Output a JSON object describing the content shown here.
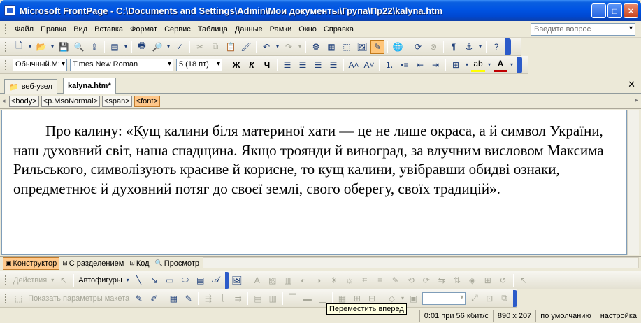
{
  "window": {
    "title": "Microsoft FrontPage - C:\\Documents and Settings\\Admin\\Мои документы\\Група\\Пр22\\kalyna.htm"
  },
  "menu": {
    "items": [
      "Файл",
      "Правка",
      "Вид",
      "Вставка",
      "Формат",
      "Сервис",
      "Таблица",
      "Данные",
      "Рамки",
      "Окно",
      "Справка"
    ],
    "help_placeholder": "Введите вопрос"
  },
  "format_toolbar": {
    "style": "Обычный.M:",
    "font": "Times New Roman",
    "size": "5 (18 пт)",
    "bold": "Ж",
    "italic": "К",
    "underline": "Ч"
  },
  "tabs": [
    {
      "label": "веб-узел"
    },
    {
      "label": "kalyna.htm*"
    }
  ],
  "tags": [
    "<body>",
    "<p.MsoNormal>",
    "<span>",
    "<font>"
  ],
  "editor": {
    "text": "Про калину: «Кущ калини біля материної хати — це не лише окраса, а й символ України, наш духовний світ, наша спадщина. Якщо троянди й виноград, за влучним висловом Максима Рильського, символізують красиве й корисне, то кущ калини, увібравши обидві ознаки, опредметнює й духовний потяг до своєї землі, свого оберегу, своїх традицій»."
  },
  "view_tabs": [
    "Конструктор",
    "С разделением",
    "Код",
    "Просмотр"
  ],
  "drawing_toolbar": {
    "actions": "Действия",
    "autoshapes": "Автофигуры"
  },
  "layout_toolbar": {
    "show_params": "Показать параметры макета"
  },
  "tooltip": "Переместить вперед",
  "status": {
    "speed": "0:01 при 56 кбит/с",
    "size": "890 x 207",
    "mode": "по умолчанию",
    "custom": "настройка"
  },
  "colors": {
    "accent": "#0054e3",
    "highlight": "#ffc88a"
  }
}
